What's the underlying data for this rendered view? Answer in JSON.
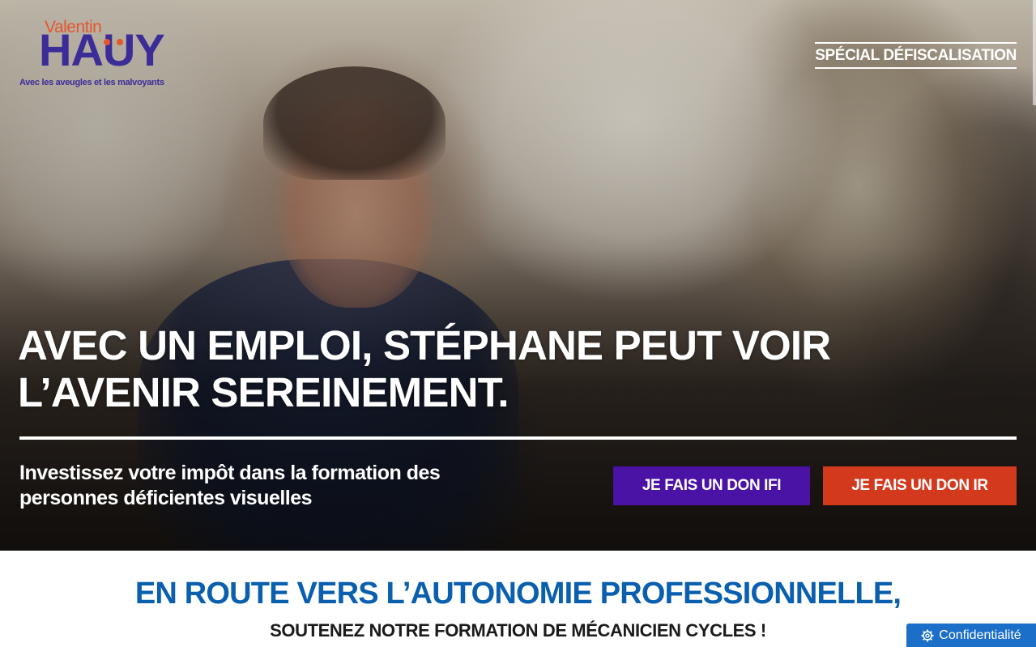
{
  "logo": {
    "valentin": "Valentin",
    "hauy": "HAUY",
    "tagline": "Avec les aveugles et les malvoyants",
    "brand_purple": "#3b2c98",
    "brand_orange": "#e4572e"
  },
  "header": {
    "special_link": "SPÉCIAL DÉFISCALISATION"
  },
  "hero": {
    "headline": "AVEC UN EMPLOI, STÉPHANE PEUT VOIR L’AVENIR SEREINEMENT.",
    "subline": "Investissez votre impôt dans la formation des personnes déficientes visuelles",
    "button_ifi": "JE FAIS UN DON IFI",
    "button_ir": "JE FAIS UN DON IR",
    "button_ifi_color": "#4a12a5",
    "button_ir_color": "#d3391d"
  },
  "section": {
    "title": "EN ROUTE VERS L’AUTONOMIE PROFESSIONNELLE,",
    "subtitle": "SOUTENEZ NOTRE FORMATION DE MÉCANICIEN CYCLES !",
    "title_color": "#0a5fae"
  },
  "privacy": {
    "label": "Confidentialité",
    "icon": "gear-icon"
  }
}
